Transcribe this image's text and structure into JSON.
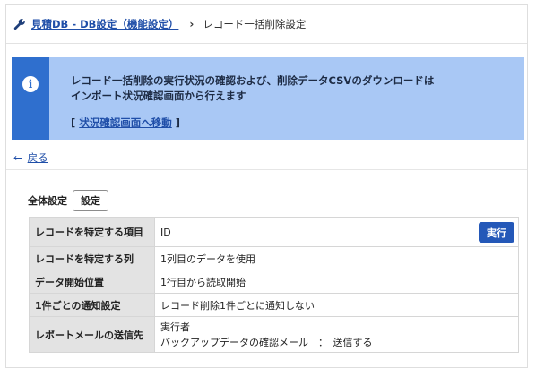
{
  "breadcrumb": {
    "parent": "見積DB - DB設定（機能設定）",
    "separator": "›",
    "current": "レコード一括削除設定"
  },
  "banner": {
    "icon": "info-icon",
    "line1": "レコード一括削除の実行状況の確認および、削除データCSVのダウンロードは",
    "line2": "インポート状況確認画面から行えます",
    "link_open": "[ ",
    "link_label": "状況確認画面へ移動",
    "link_close": " ]"
  },
  "back": {
    "arrow": "←",
    "label": "戻る"
  },
  "settings": {
    "label": "全体設定",
    "button": "設定",
    "run_button": "実行",
    "rows": [
      {
        "key": "レコードを特定する項目",
        "value": "ID"
      },
      {
        "key": "レコードを特定する列",
        "value": "1列目のデータを使用"
      },
      {
        "key": "データ開始位置",
        "value": "1行目から読取開始"
      },
      {
        "key": "1件ごとの通知設定",
        "value": "レコード削除1件ごとに通知しない"
      },
      {
        "key": "レポートメールの送信先",
        "value_line1": "実行者",
        "value_line2": "バックアップデータの確認メール　：　送信する"
      }
    ]
  },
  "colors": {
    "accent": "#2f6fce",
    "banner_bg": "#a9c8f5",
    "link": "#1f4ea8",
    "button": "#2458b8"
  }
}
